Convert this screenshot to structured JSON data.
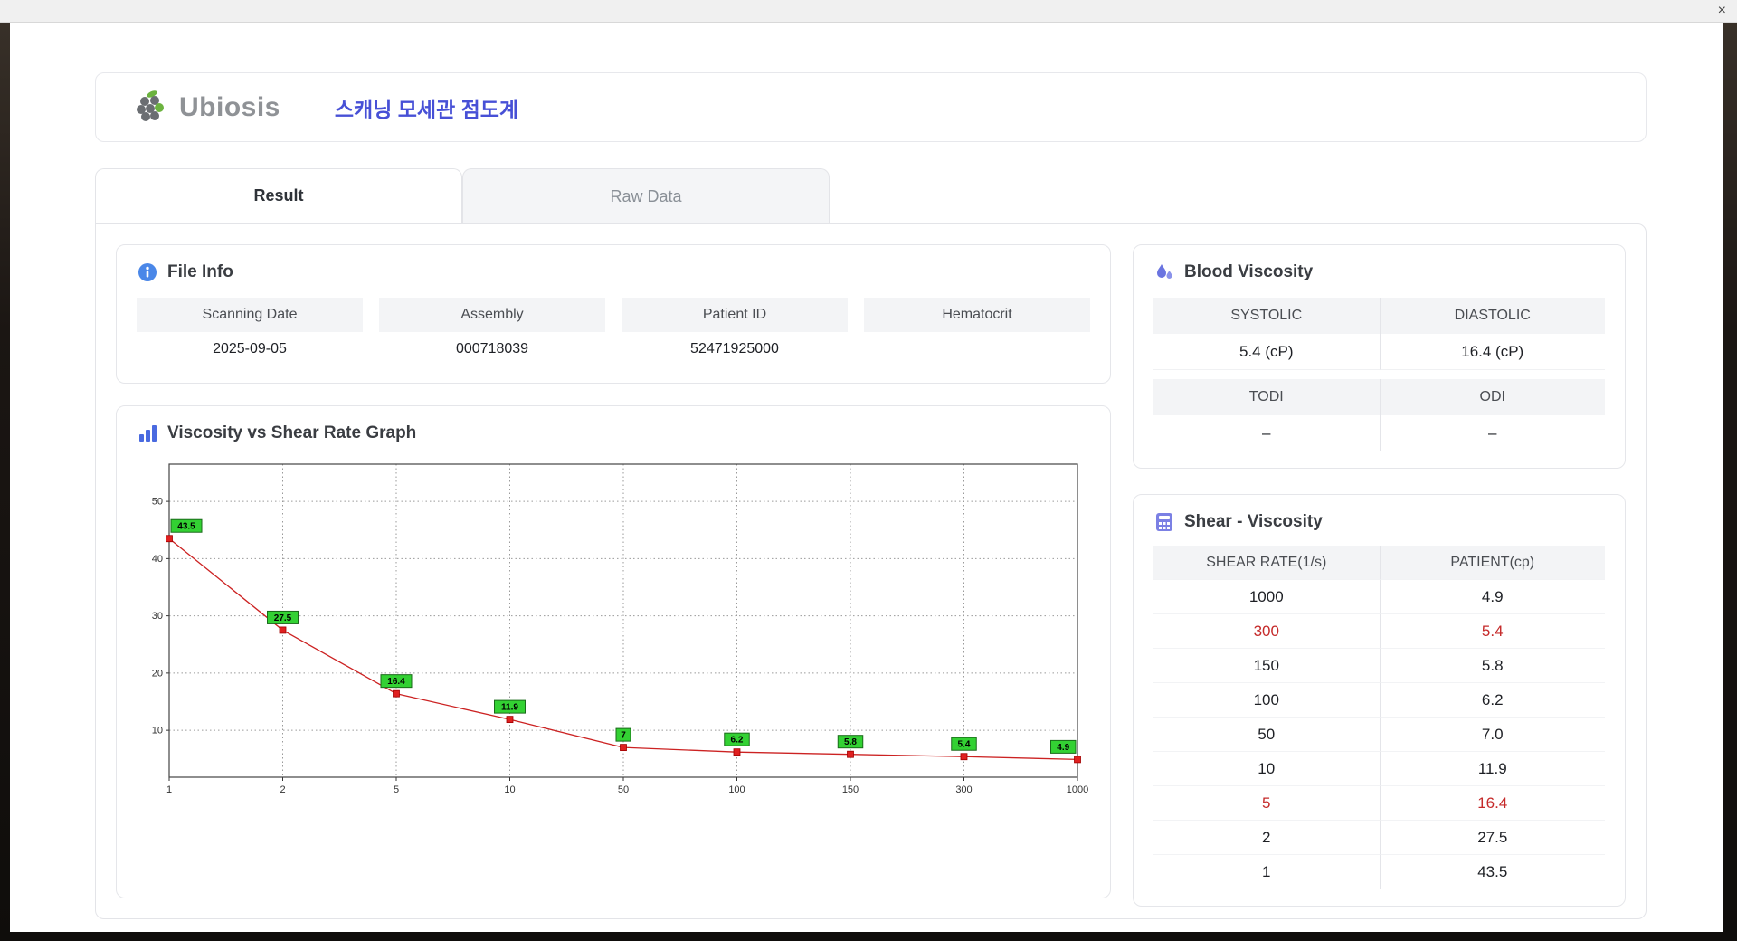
{
  "window": {
    "close_label": "×"
  },
  "header": {
    "brand_initial": "U",
    "brand_rest": "biosis",
    "title_korean": "스캐닝 모세관 점도계"
  },
  "tabs": [
    {
      "label": "Result",
      "active": true
    },
    {
      "label": "Raw Data",
      "active": false
    }
  ],
  "file_info": {
    "title": "File Info",
    "fields": [
      {
        "label": "Scanning Date",
        "value": "2025-09-05"
      },
      {
        "label": "Assembly",
        "value": "000718039"
      },
      {
        "label": "Patient ID",
        "value": "52471925000"
      },
      {
        "label": "Hematocrit",
        "value": ""
      }
    ]
  },
  "blood_viscosity": {
    "title": "Blood Viscosity",
    "rows": [
      {
        "headers": [
          "SYSTOLIC",
          "DIASTOLIC"
        ],
        "values": [
          "5.4 (cP)",
          "16.4 (cP)"
        ]
      },
      {
        "headers": [
          "TODI",
          "ODI"
        ],
        "values": [
          "–",
          "–"
        ]
      }
    ]
  },
  "graph": {
    "title": "Viscosity vs Shear Rate Graph"
  },
  "chart_data": {
    "type": "line",
    "title": "Viscosity vs Shear Rate Graph",
    "x_axis_type": "category-log",
    "x": [
      "1",
      "2",
      "5",
      "10",
      "50",
      "100",
      "150",
      "300",
      "1000"
    ],
    "series": [
      {
        "name": "PATIENT(cp)",
        "values": [
          43.5,
          27.5,
          16.4,
          11.9,
          7.0,
          6.2,
          5.8,
          5.4,
          4.9
        ]
      }
    ],
    "point_labels": [
      "43.5",
      "27.5",
      "16.4",
      "11.9",
      "7",
      "6.2",
      "5.8",
      "5.4",
      "4.9"
    ],
    "y_ticks": [
      10,
      20,
      30,
      40,
      50
    ],
    "ylim": [
      1.8,
      56.5
    ],
    "grid": "dotted",
    "legend": "none",
    "line_color": "#cc2222",
    "marker_color": "#e02020",
    "marker_stroke": "#a00000",
    "label_bg": "#33d133",
    "label_border": "#1a6a1a"
  },
  "shear_viscosity": {
    "title": "Shear - Viscosity",
    "columns": [
      "SHEAR RATE(1/s)",
      "PATIENT(cp)"
    ],
    "rows": [
      {
        "shear": "1000",
        "patient": "4.9",
        "highlight": false
      },
      {
        "shear": "300",
        "patient": "5.4",
        "highlight": true
      },
      {
        "shear": "150",
        "patient": "5.8",
        "highlight": false
      },
      {
        "shear": "100",
        "patient": "6.2",
        "highlight": false
      },
      {
        "shear": "50",
        "patient": "7.0",
        "highlight": false
      },
      {
        "shear": "10",
        "patient": "11.9",
        "highlight": false
      },
      {
        "shear": "5",
        "patient": "16.4",
        "highlight": true
      },
      {
        "shear": "2",
        "patient": "27.5",
        "highlight": false
      },
      {
        "shear": "1",
        "patient": "43.5",
        "highlight": false
      }
    ]
  },
  "colors": {
    "accent_blue": "#4750d6",
    "brand_gray": "#8f9296",
    "logo_green": "#6cb33f",
    "highlight_red": "#c52a2a",
    "table_header_bg": "#f3f4f6",
    "chart_line": "#cc2222",
    "chart_label_bg": "#33d133"
  }
}
